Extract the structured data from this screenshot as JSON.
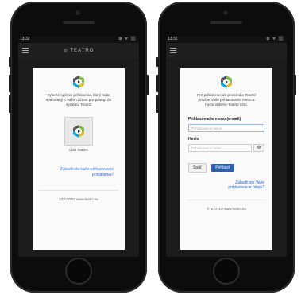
{
  "status": {
    "time": "13:32",
    "indicators": "⚙ ᯤ ⬛"
  },
  "left_screen": {
    "brand": "TEATRO",
    "description": "Vyberte spôsob prihlásenia, ktorý máte spárovaný s Vaším účtom pre prístup do systému TeatrO",
    "tile_label": "účet TeatrO",
    "struck_link": "Zabudli ste Vaše prihlasovacie",
    "help_link": "prihlásenia?",
    "footer": "©TEATRO www.teatro.eu"
  },
  "right_screen": {
    "intro": "Pre prihlásenie do prostredia TeatrO použite Vaše prihlasovacie meno a heslo Vašeho TeatrO účtu.",
    "login_label": "Prihlasovacie meno (e-mail)",
    "login_placeholder": "Prihlasovacie meno",
    "password_label": "Heslo",
    "password_placeholder": "Prihlasovacie heslo",
    "back_button": "Späť",
    "submit_button": "Prihlásiť",
    "forgot_link_1": "Zabudli ste Vaše",
    "forgot_link_2": "prihlasovacie údaje?",
    "footer": "©TEATRO www.teatro.eu"
  }
}
